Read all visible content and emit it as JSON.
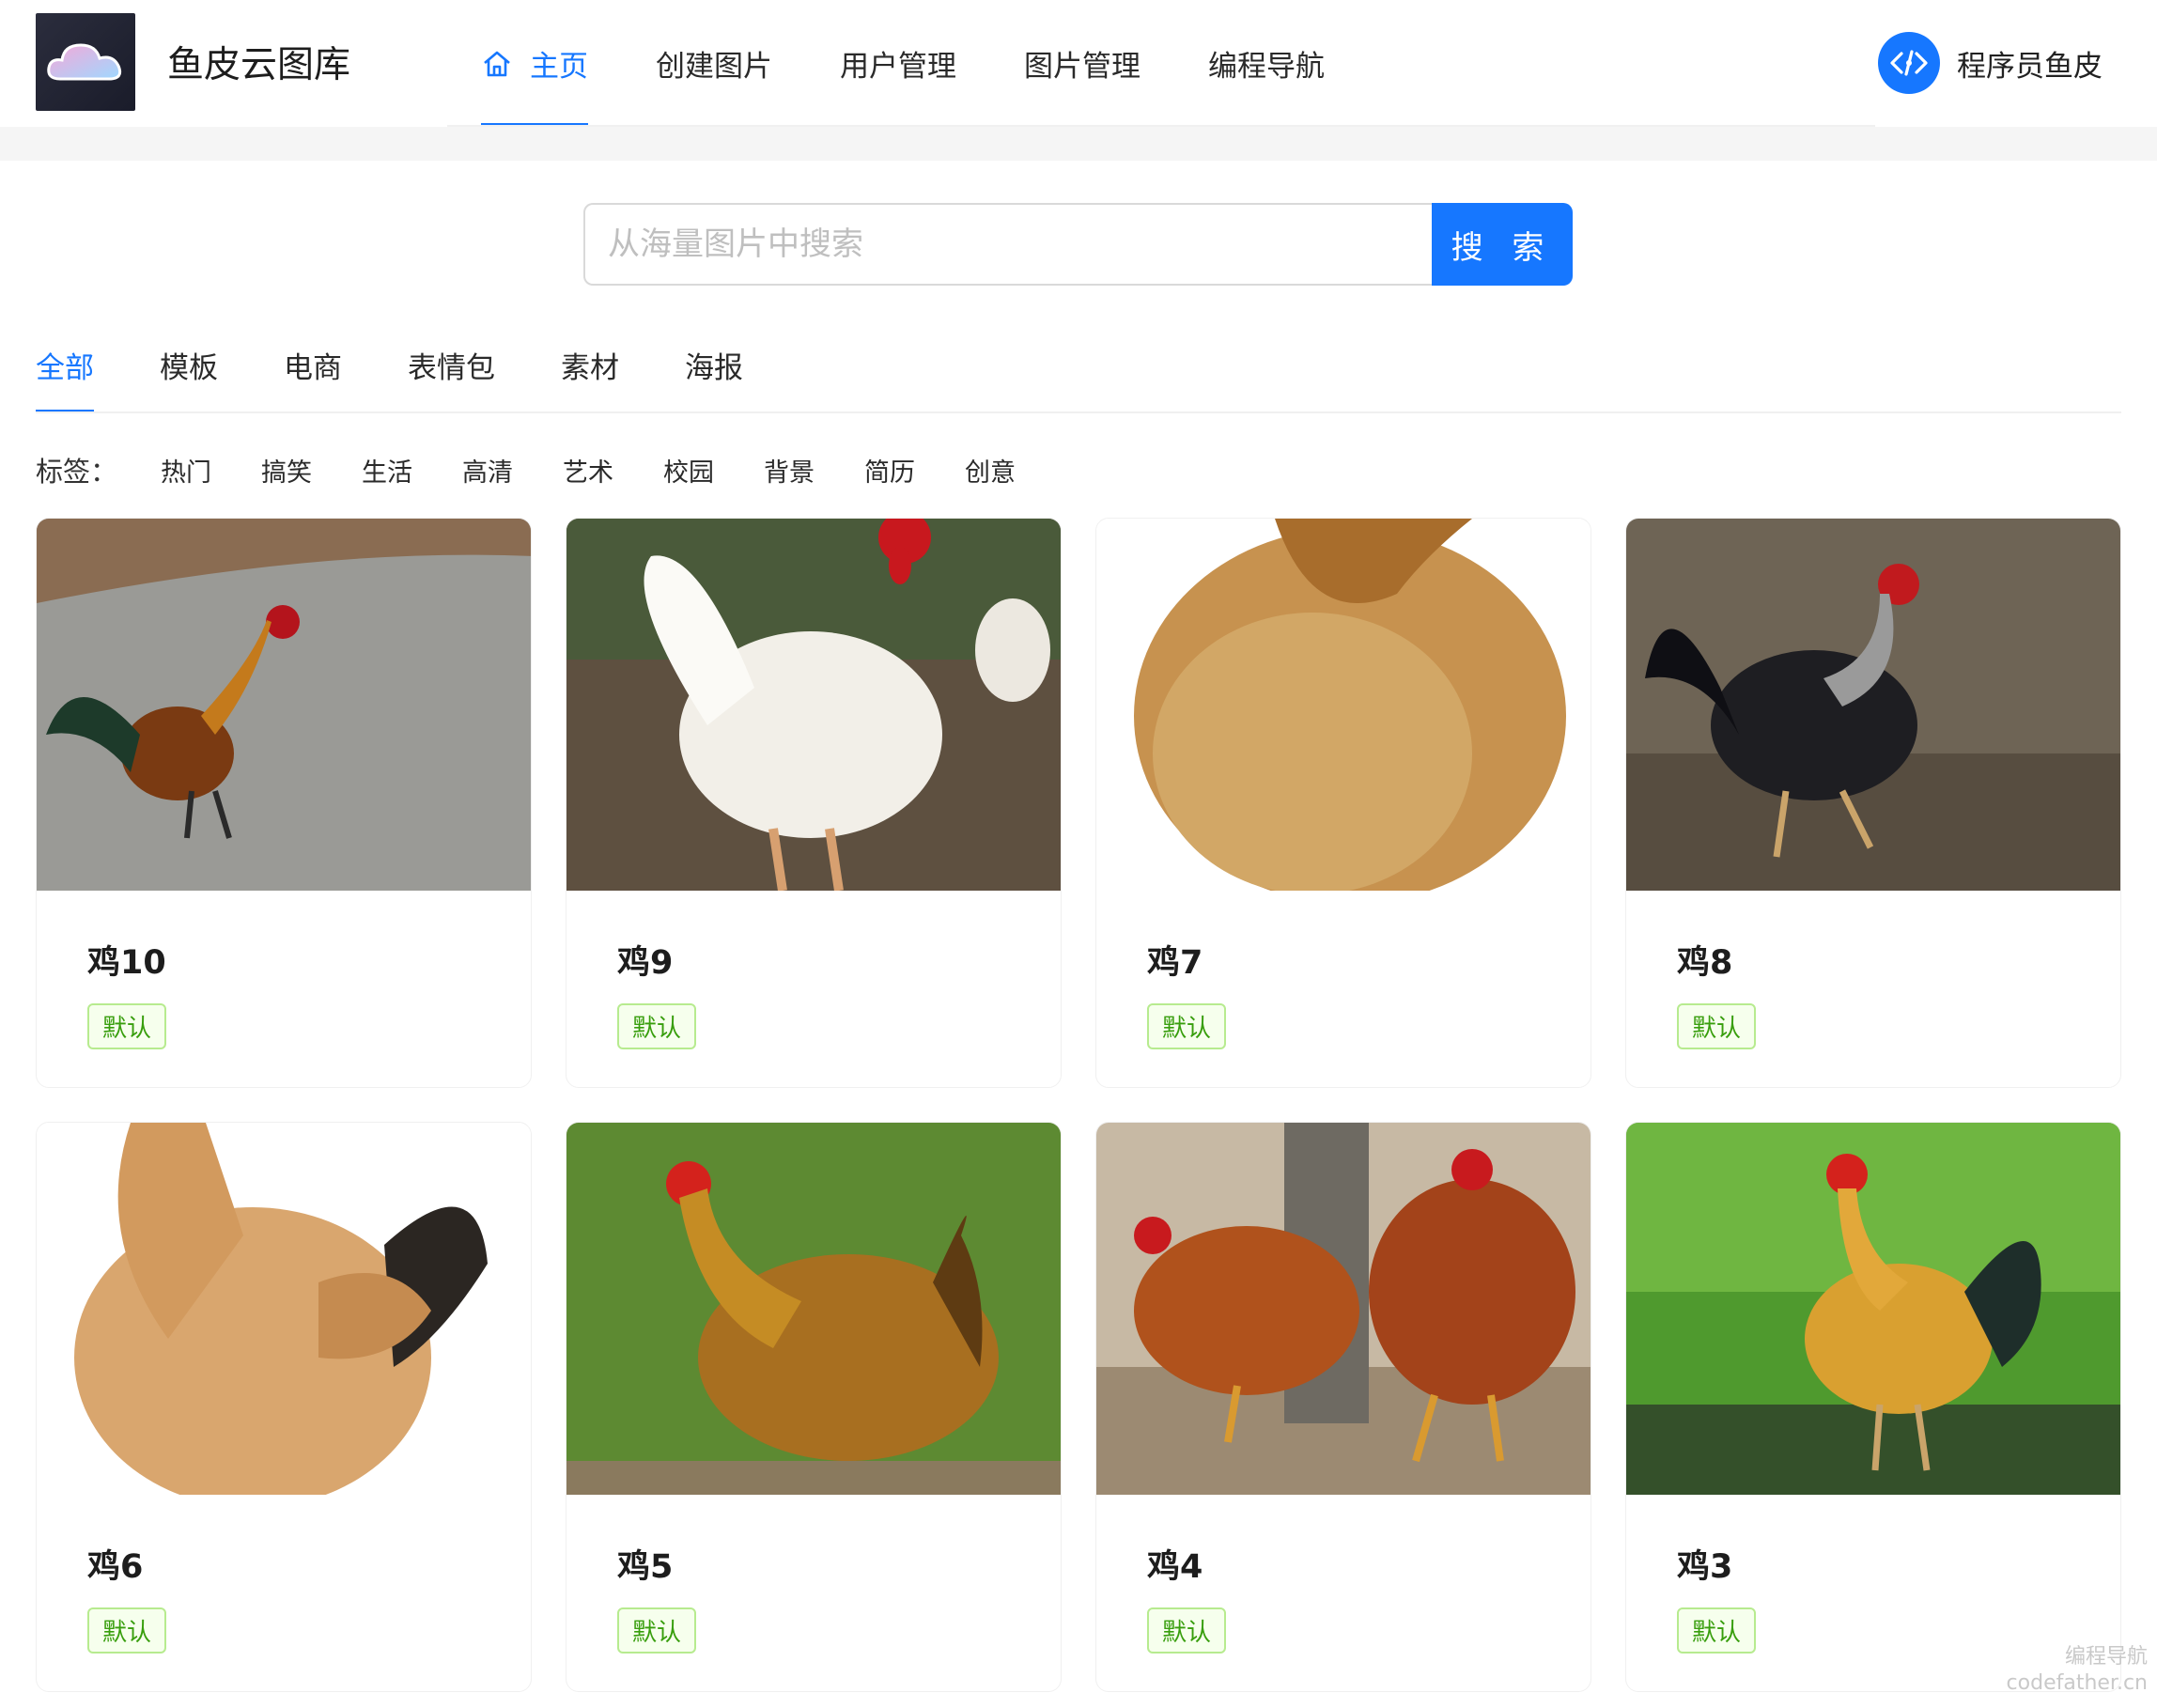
{
  "header": {
    "site_title": "鱼皮云图库",
    "nav": [
      {
        "label": "主页",
        "active": true,
        "icon": "home-icon"
      },
      {
        "label": "创建图片",
        "active": false
      },
      {
        "label": "用户管理",
        "active": false
      },
      {
        "label": "图片管理",
        "active": false
      },
      {
        "label": "编程导航",
        "active": false
      }
    ],
    "user_name": "程序员鱼皮",
    "accent": "#1677ff"
  },
  "search": {
    "placeholder": "从海量图片中搜索",
    "value": "",
    "button_label": "搜 索"
  },
  "categories": [
    {
      "label": "全部",
      "active": true
    },
    {
      "label": "模板",
      "active": false
    },
    {
      "label": "电商",
      "active": false
    },
    {
      "label": "表情包",
      "active": false
    },
    {
      "label": "素材",
      "active": false
    },
    {
      "label": "海报",
      "active": false
    }
  ],
  "tags": {
    "label": "标签：",
    "items": [
      "热门",
      "搞笑",
      "生活",
      "高清",
      "艺术",
      "校园",
      "背景",
      "简历",
      "创意"
    ]
  },
  "pictures": [
    {
      "title": "鸡10",
      "category": "默认"
    },
    {
      "title": "鸡9",
      "category": "默认"
    },
    {
      "title": "鸡7",
      "category": "默认"
    },
    {
      "title": "鸡8",
      "category": "默认"
    },
    {
      "title": "鸡6",
      "category": "默认"
    },
    {
      "title": "鸡5",
      "category": "默认"
    },
    {
      "title": "鸡4",
      "category": "默认"
    },
    {
      "title": "鸡3",
      "category": "默认"
    }
  ],
  "watermark": {
    "line1": "编程导航",
    "line2": "codefather.cn"
  }
}
